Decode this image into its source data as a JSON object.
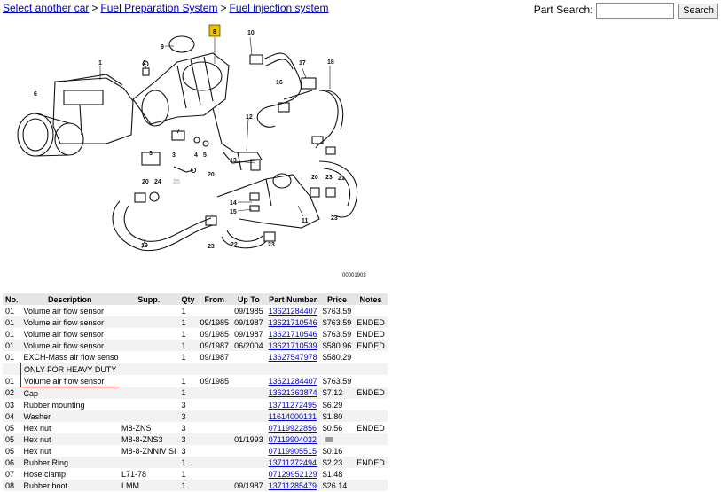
{
  "breadcrumb": {
    "items": [
      "Select another car",
      "Fuel Preparation System",
      "Fuel injection system"
    ],
    "separator": ">"
  },
  "search": {
    "label": "Part Search:",
    "value": "",
    "button": "Search"
  },
  "diagram": {
    "callouts": [
      "1",
      "2",
      "3",
      "4",
      "5",
      "6",
      "7",
      "8",
      "9",
      "10",
      "11",
      "12",
      "13",
      "14",
      "15",
      "16",
      "17",
      "18",
      "19",
      "20",
      "21",
      "22",
      "23",
      "24",
      "25"
    ],
    "highlighted": "8",
    "code": "00001903"
  },
  "table": {
    "headers": [
      "No.",
      "Description",
      "Supp.",
      "Qty",
      "From",
      "Up To",
      "Part Number",
      "Price",
      "Notes"
    ],
    "rows": [
      {
        "no": "01",
        "desc": "Volume air flow sensor",
        "supp": "",
        "qty": "1",
        "from": "",
        "upto": "09/1985",
        "part": "13621284407",
        "price": "$763.59",
        "notes": ""
      },
      {
        "no": "01",
        "desc": "Volume air flow sensor",
        "supp": "",
        "qty": "1",
        "from": "09/1985",
        "upto": "09/1987",
        "part": "13621710546",
        "price": "$763.59",
        "notes": "ENDED"
      },
      {
        "no": "01",
        "desc": "Volume air flow sensor",
        "supp": "",
        "qty": "1",
        "from": "09/1985",
        "upto": "09/1987",
        "part": "13621710546",
        "price": "$763.59",
        "notes": "ENDED"
      },
      {
        "no": "01",
        "desc": "Volume air flow sensor",
        "supp": "",
        "qty": "1",
        "from": "09/1987",
        "upto": "06/2004",
        "part": "13621710539",
        "price": "$580.96",
        "notes": "ENDED"
      },
      {
        "no": "01",
        "desc": "EXCH-Mass air flow sensor",
        "supp": "",
        "qty": "1",
        "from": "09/1987",
        "upto": "",
        "part": "13627547978",
        "price": "$580.29",
        "notes": ""
      },
      {
        "no": "",
        "desc": "ONLY FOR HEAVY DUTY",
        "supp": "",
        "qty": "",
        "from": "",
        "upto": "",
        "part": "",
        "price": "",
        "notes": ""
      },
      {
        "no": "01",
        "desc": "Volume air flow sensor",
        "supp": "",
        "qty": "1",
        "from": "09/1985",
        "upto": "",
        "part": "13621284407",
        "price": "$763.59",
        "notes": ""
      },
      {
        "no": "02",
        "desc": "Cap",
        "supp": "",
        "qty": "1",
        "from": "",
        "upto": "",
        "part": "13621363874",
        "price": "$7.12",
        "notes": "ENDED"
      },
      {
        "no": "03",
        "desc": "Rubber mounting",
        "supp": "",
        "qty": "3",
        "from": "",
        "upto": "",
        "part": "13711272495",
        "price": "$6.29",
        "notes": ""
      },
      {
        "no": "04",
        "desc": "Washer",
        "supp": "",
        "qty": "3",
        "from": "",
        "upto": "",
        "part": "11614000131",
        "price": "$1.80",
        "notes": ""
      },
      {
        "no": "05",
        "desc": "Hex nut",
        "supp": "M8-ZNS",
        "qty": "3",
        "from": "",
        "upto": "",
        "part": "07119922856",
        "price": "$0.56",
        "notes": "ENDED"
      },
      {
        "no": "05",
        "desc": "Hex nut",
        "supp": "M8-8-ZNS3",
        "qty": "3",
        "from": "",
        "upto": "01/1993",
        "part": "07119904032",
        "price": "$0.16",
        "notes": ""
      },
      {
        "no": "05",
        "desc": "Hex nut",
        "supp": "M8-8-ZNNIV SI",
        "qty": "3",
        "from": "",
        "upto": "",
        "part": "07119905515",
        "price": "$0.16",
        "notes": ""
      },
      {
        "no": "06",
        "desc": "Rubber Ring",
        "supp": "",
        "qty": "1",
        "from": "",
        "upto": "",
        "part": "13711272494",
        "price": "$2.23",
        "notes": "ENDED"
      },
      {
        "no": "07",
        "desc": "Hose clamp",
        "supp": "L71-78",
        "qty": "1",
        "from": "",
        "upto": "",
        "part": "07129952129",
        "price": "$1.48",
        "notes": ""
      },
      {
        "no": "08",
        "desc": "Rubber boot",
        "supp": "LMM",
        "qty": "1",
        "from": "",
        "upto": "09/1987",
        "part": "13711285479",
        "price": "$26.14",
        "notes": ""
      }
    ]
  }
}
